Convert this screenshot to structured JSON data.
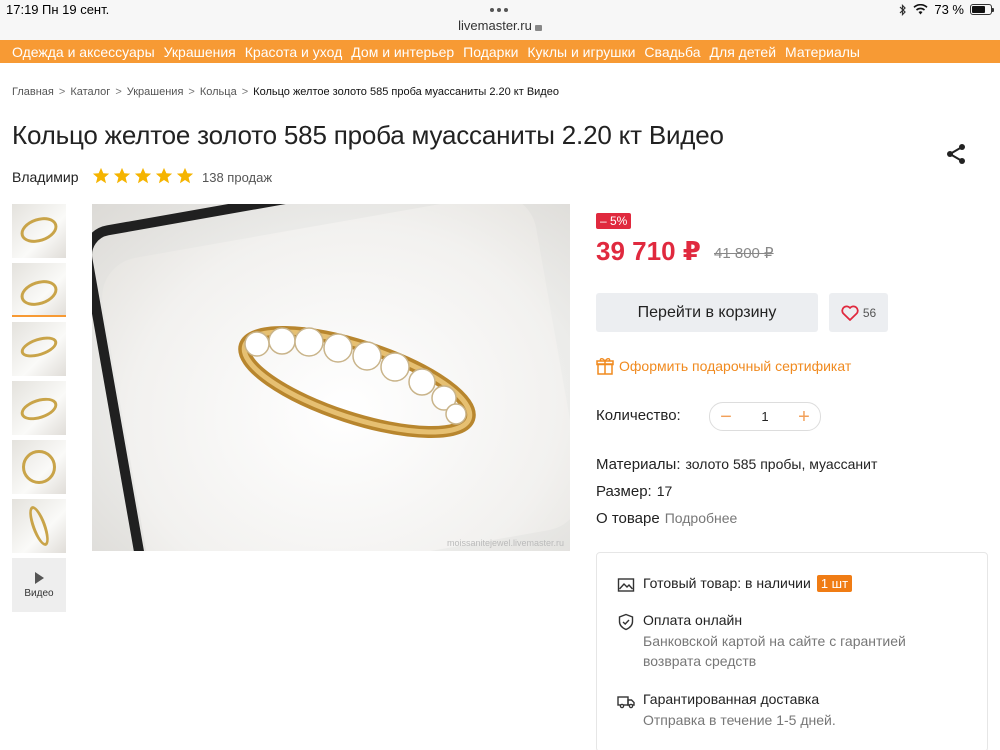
{
  "status_bar": {
    "time": "17:19",
    "date": "Пн 19 сент.",
    "url": "livemaster.ru",
    "battery_percent": "73 %",
    "battery_level": 0.73
  },
  "category_nav": [
    "Одежда и аксессуары",
    "Украшения",
    "Красота и уход",
    "Дом и интерьер",
    "Подарки",
    "Куклы и игрушки",
    "Свадьба",
    "Для детей",
    "Материалы"
  ],
  "breadcrumb": {
    "items": [
      "Главная",
      "Каталог",
      "Украшения",
      "Кольца"
    ],
    "current": "Кольцо желтое золото 585 проба муассаниты 2.20 кт Видео",
    "separator": ">"
  },
  "product": {
    "title": "Кольцо желтое золото 585 проба муассаниты 2.20 кт Видео",
    "seller": "Владимир",
    "rating_stars": 5,
    "sales": "138 продаж",
    "image_watermark": "moissanitejewel.livemaster.ru",
    "video_label": "Видео",
    "discount": "– 5%",
    "price": "39 710 ₽",
    "old_price": "41 800 ₽",
    "cart_button": "Перейти в корзину",
    "favorites_count": "56",
    "gift_certificate": "Оформить подарочный сертификат",
    "quantity_label": "Количество:",
    "quantity_value": "1",
    "materials_label": "Материалы:",
    "materials_value": "золото 585 пробы, муассанит",
    "size_label": "Размер:",
    "size_value": "17",
    "about_label": "О товаре",
    "about_link": "Подробнее"
  },
  "info": {
    "stock_label": "Готовый товар: в наличии",
    "stock_badge": "1 шт",
    "payment_title": "Оплата онлайн",
    "payment_desc_1": "Банковской картой на сайте с гарантией",
    "payment_desc_2": "возврата средств",
    "delivery_title": "Гарантированная доставка",
    "delivery_desc": "Отправка в течение 1-5 дней."
  },
  "colors": {
    "accent_orange": "#f79a34",
    "price_red": "#e0293e",
    "star_yellow": "#f5b400"
  }
}
